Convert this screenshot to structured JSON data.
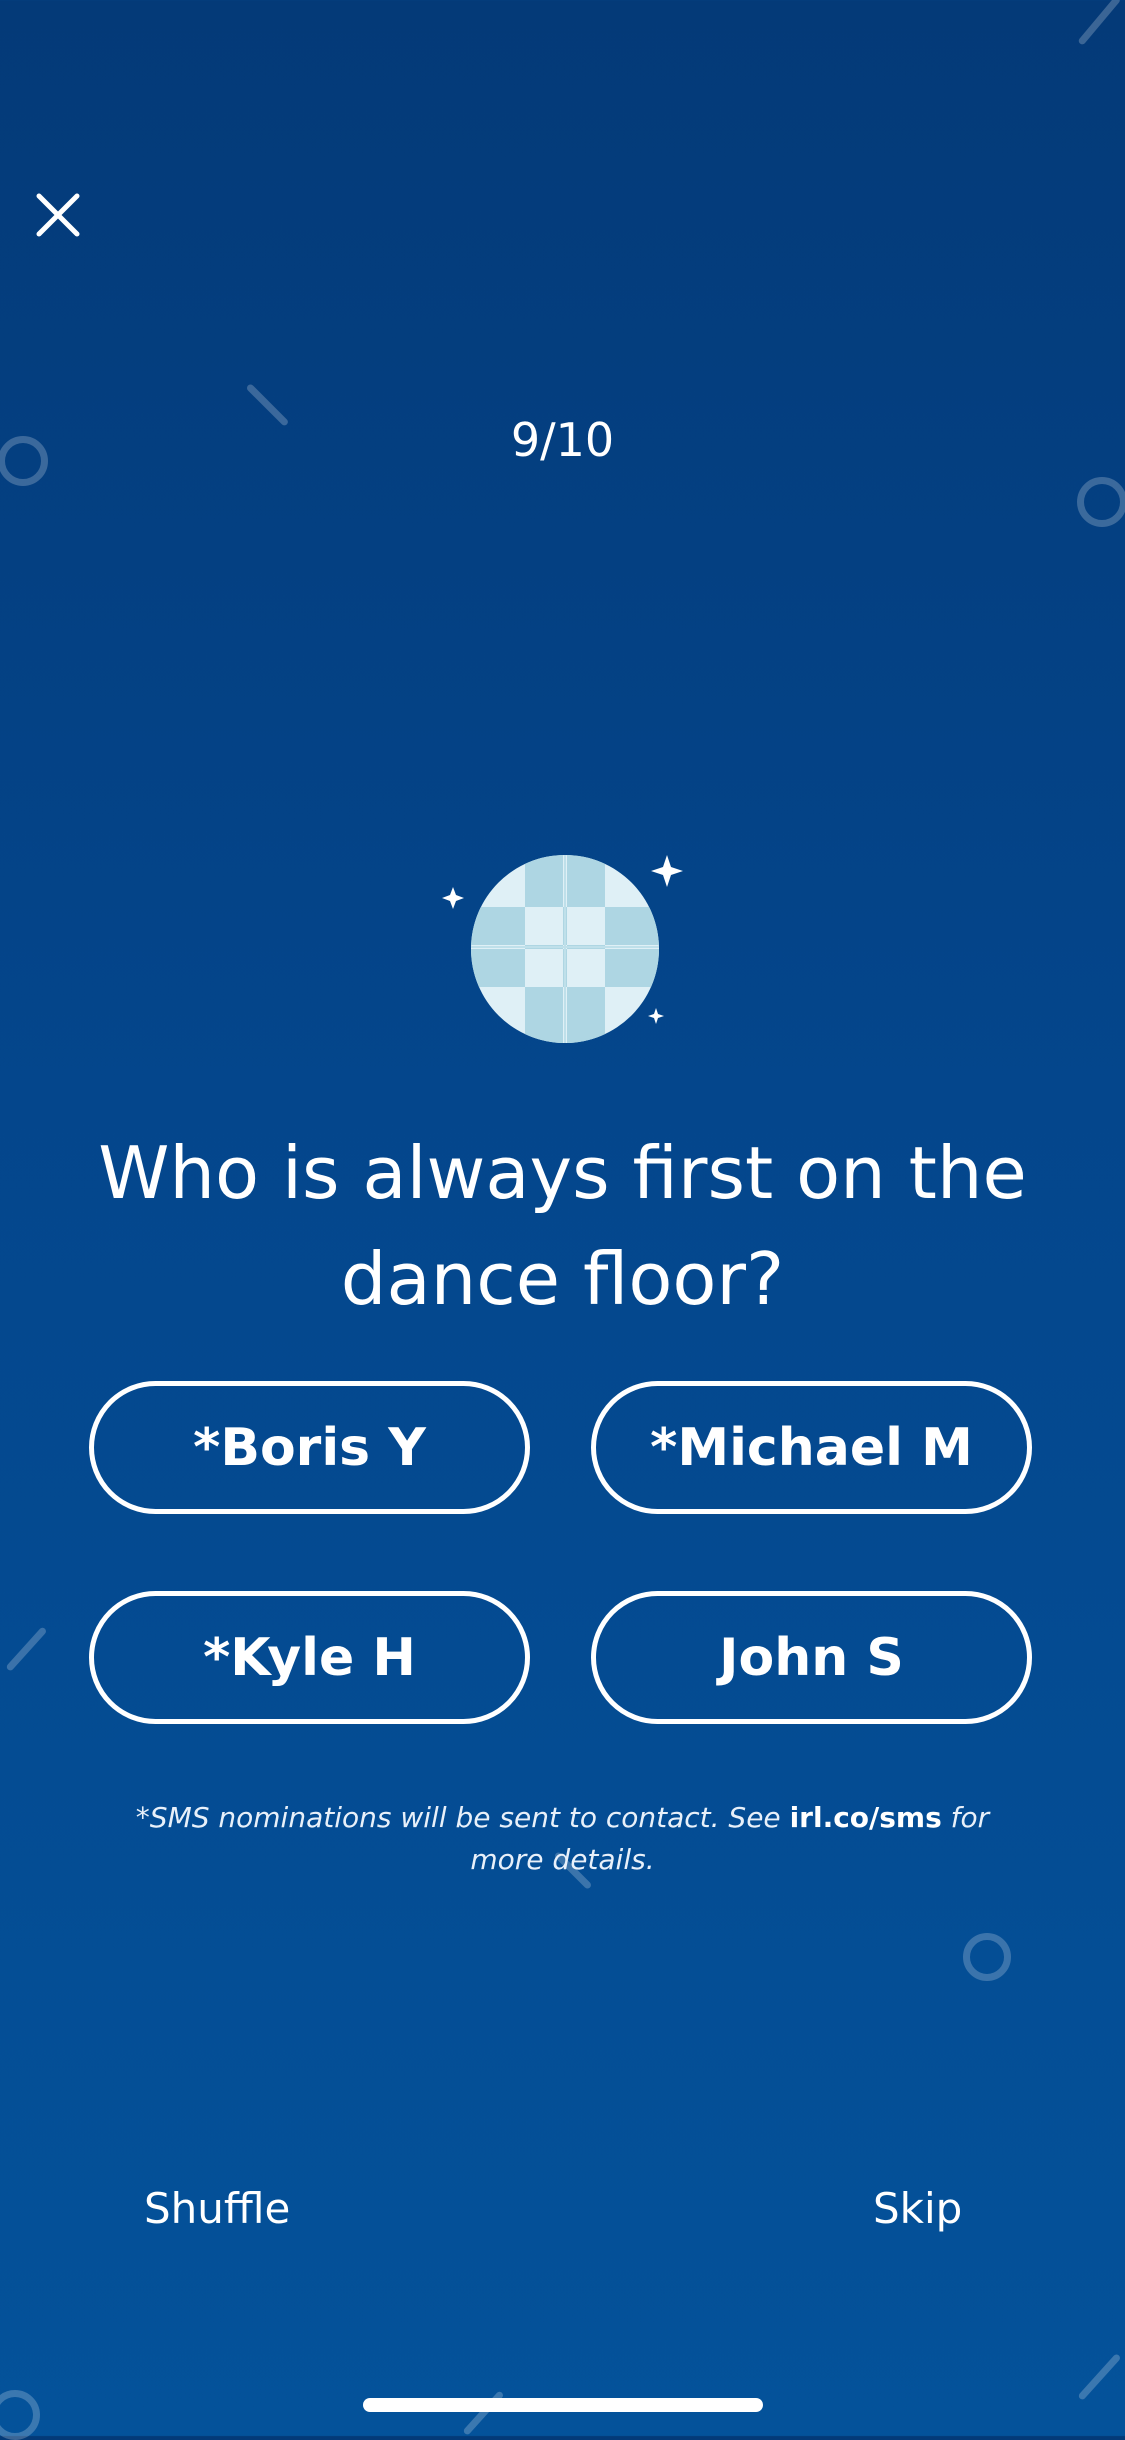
{
  "header": {
    "close_icon": "close-icon",
    "progress_text": "9/10"
  },
  "question": {
    "icon": "disco-ball-icon",
    "text": "Who is always first on the dance floor?"
  },
  "options": [
    {
      "label": "*Boris Y"
    },
    {
      "label": "*Michael M"
    },
    {
      "label": "*Kyle H"
    },
    {
      "label": "John S"
    }
  ],
  "disclaimer": {
    "prefix": "*SMS nominations will be sent to contact. See ",
    "link": "irl.co/sms",
    "suffix": " for more details."
  },
  "footer": {
    "shuffle_label": "Shuffle",
    "skip_label": "Skip"
  },
  "colors": {
    "background_top": "#043a78",
    "background_bottom": "#04529a",
    "text": "#ffffff",
    "disco_ball_light": "#dff0f6",
    "disco_ball_dark": "#aed6e3"
  }
}
